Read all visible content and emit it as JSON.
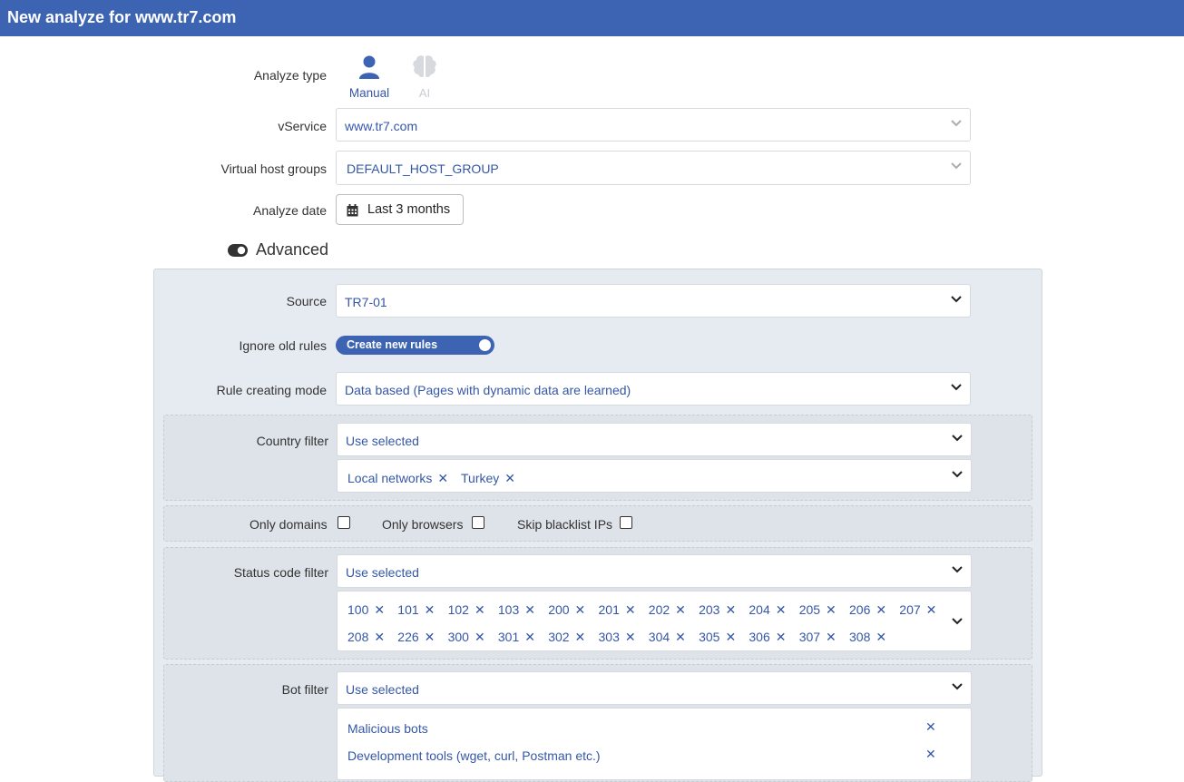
{
  "window": {
    "title": "New analyze for www.tr7.com"
  },
  "analyze_type": {
    "label": "Analyze type",
    "options": [
      {
        "label": "Manual",
        "icon": "person-icon",
        "selected": true
      },
      {
        "label": "AI",
        "icon": "brain-icon",
        "selected": false
      }
    ]
  },
  "vservice": {
    "label": "vService",
    "value": "www.tr7.com"
  },
  "virtual_host_groups": {
    "label": "Virtual host groups",
    "value": "DEFAULT_HOST_GROUP"
  },
  "analyze_date": {
    "label": "Analyze date",
    "button_label": "Last 3 months"
  },
  "advanced": {
    "label": "Advanced",
    "toggle_on": true
  },
  "source": {
    "label": "Source",
    "value": "TR7-01"
  },
  "ignore_old_rules": {
    "label": "Ignore old rules",
    "toggle_label": "Create new rules",
    "on": true
  },
  "rule_creating_mode": {
    "label": "Rule creating mode",
    "value": "Data based (Pages with dynamic data are learned)"
  },
  "country_filter": {
    "label": "Country filter",
    "mode": "Use selected",
    "selected": [
      "Local networks",
      "Turkey"
    ]
  },
  "checkboxes": {
    "only_domains": {
      "label": "Only domains",
      "checked": false
    },
    "only_browsers": {
      "label": "Only browsers",
      "checked": false
    },
    "skip_blacklist": {
      "label": "Skip blacklist IPs",
      "checked": false
    }
  },
  "status_code_filter": {
    "label": "Status code filter",
    "mode": "Use selected",
    "codes_row1": [
      "100",
      "101",
      "102",
      "103",
      "200",
      "201",
      "202",
      "203",
      "204",
      "205",
      "206",
      "207"
    ],
    "codes_row2": [
      "208",
      "226",
      "300",
      "301",
      "302",
      "303",
      "304",
      "305",
      "306",
      "307",
      "308"
    ]
  },
  "bot_filter": {
    "label": "Bot filter",
    "mode": "Use selected",
    "selected": [
      "Malicious bots",
      "Development tools (wget, curl, Postman etc.)"
    ]
  },
  "colors": {
    "accent": "#3d64b3",
    "link": "#3557a8",
    "panel": "#e6ebf1"
  }
}
